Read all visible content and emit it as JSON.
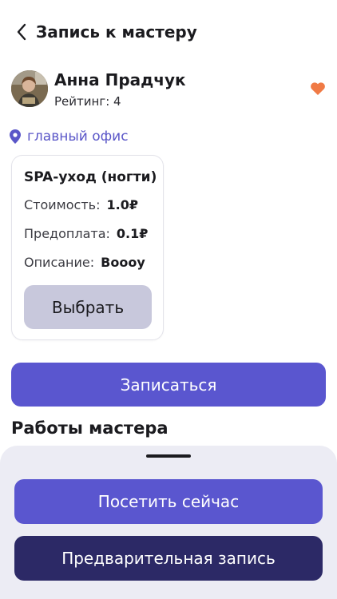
{
  "header": {
    "title": "Запись к мастеру",
    "back_icon": "chevron-left-icon"
  },
  "master": {
    "name": "Анна Прадчук",
    "rating_text": "Рейтинг: 4",
    "favorite_icon": "heart-icon",
    "favorite_color": "#f07a45"
  },
  "office": {
    "label": "главный офис",
    "icon": "location-pin-icon",
    "color": "#5a56c8"
  },
  "service": {
    "title": "SPA-уход (ногти)",
    "price_label": "Стоимость:",
    "price_value": "1.0₽",
    "prepay_label": "Предоплата:",
    "prepay_value": "0.1₽",
    "desc_label": "Описание:",
    "desc_value": "Boooy",
    "select_label": "Выбрать"
  },
  "actions": {
    "book_label": "Записаться"
  },
  "works": {
    "title": "Работы мастера"
  },
  "sheet": {
    "visit_now_label": "Посетить сейчас",
    "pre_booking_label": "Предварительная запись"
  },
  "colors": {
    "primary": "#5a56cf",
    "dark": "#2c2966",
    "select_bg": "#c8c8dc",
    "sheet_bg": "#ececf4"
  }
}
